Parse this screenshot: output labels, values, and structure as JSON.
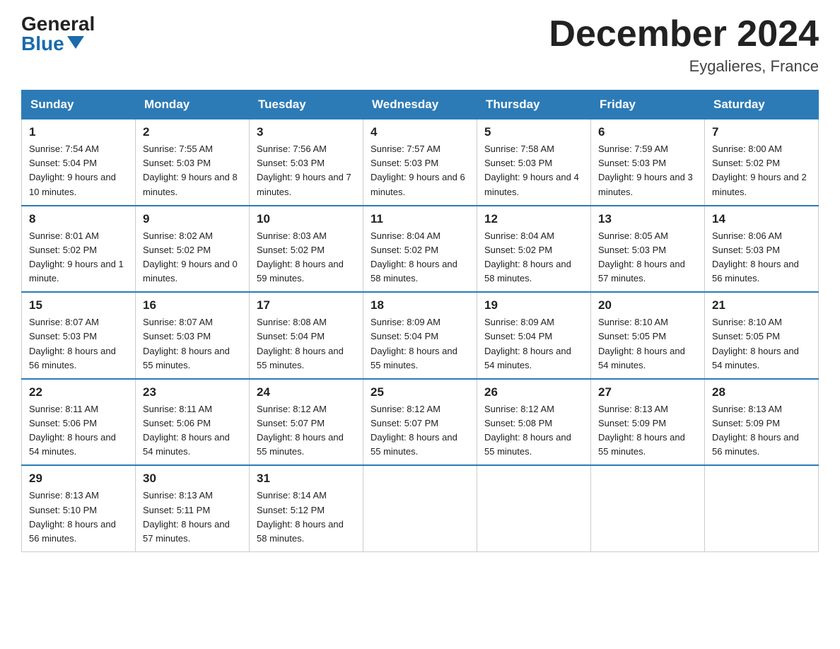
{
  "header": {
    "logo_general": "General",
    "logo_blue": "Blue",
    "month_title": "December 2024",
    "location": "Eygalieres, France"
  },
  "days_of_week": [
    "Sunday",
    "Monday",
    "Tuesday",
    "Wednesday",
    "Thursday",
    "Friday",
    "Saturday"
  ],
  "weeks": [
    [
      {
        "day": "1",
        "sunrise": "7:54 AM",
        "sunset": "5:04 PM",
        "daylight": "9 hours and 10 minutes."
      },
      {
        "day": "2",
        "sunrise": "7:55 AM",
        "sunset": "5:03 PM",
        "daylight": "9 hours and 8 minutes."
      },
      {
        "day": "3",
        "sunrise": "7:56 AM",
        "sunset": "5:03 PM",
        "daylight": "9 hours and 7 minutes."
      },
      {
        "day": "4",
        "sunrise": "7:57 AM",
        "sunset": "5:03 PM",
        "daylight": "9 hours and 6 minutes."
      },
      {
        "day": "5",
        "sunrise": "7:58 AM",
        "sunset": "5:03 PM",
        "daylight": "9 hours and 4 minutes."
      },
      {
        "day": "6",
        "sunrise": "7:59 AM",
        "sunset": "5:03 PM",
        "daylight": "9 hours and 3 minutes."
      },
      {
        "day": "7",
        "sunrise": "8:00 AM",
        "sunset": "5:02 PM",
        "daylight": "9 hours and 2 minutes."
      }
    ],
    [
      {
        "day": "8",
        "sunrise": "8:01 AM",
        "sunset": "5:02 PM",
        "daylight": "9 hours and 1 minute."
      },
      {
        "day": "9",
        "sunrise": "8:02 AM",
        "sunset": "5:02 PM",
        "daylight": "9 hours and 0 minutes."
      },
      {
        "day": "10",
        "sunrise": "8:03 AM",
        "sunset": "5:02 PM",
        "daylight": "8 hours and 59 minutes."
      },
      {
        "day": "11",
        "sunrise": "8:04 AM",
        "sunset": "5:02 PM",
        "daylight": "8 hours and 58 minutes."
      },
      {
        "day": "12",
        "sunrise": "8:04 AM",
        "sunset": "5:02 PM",
        "daylight": "8 hours and 58 minutes."
      },
      {
        "day": "13",
        "sunrise": "8:05 AM",
        "sunset": "5:03 PM",
        "daylight": "8 hours and 57 minutes."
      },
      {
        "day": "14",
        "sunrise": "8:06 AM",
        "sunset": "5:03 PM",
        "daylight": "8 hours and 56 minutes."
      }
    ],
    [
      {
        "day": "15",
        "sunrise": "8:07 AM",
        "sunset": "5:03 PM",
        "daylight": "8 hours and 56 minutes."
      },
      {
        "day": "16",
        "sunrise": "8:07 AM",
        "sunset": "5:03 PM",
        "daylight": "8 hours and 55 minutes."
      },
      {
        "day": "17",
        "sunrise": "8:08 AM",
        "sunset": "5:04 PM",
        "daylight": "8 hours and 55 minutes."
      },
      {
        "day": "18",
        "sunrise": "8:09 AM",
        "sunset": "5:04 PM",
        "daylight": "8 hours and 55 minutes."
      },
      {
        "day": "19",
        "sunrise": "8:09 AM",
        "sunset": "5:04 PM",
        "daylight": "8 hours and 54 minutes."
      },
      {
        "day": "20",
        "sunrise": "8:10 AM",
        "sunset": "5:05 PM",
        "daylight": "8 hours and 54 minutes."
      },
      {
        "day": "21",
        "sunrise": "8:10 AM",
        "sunset": "5:05 PM",
        "daylight": "8 hours and 54 minutes."
      }
    ],
    [
      {
        "day": "22",
        "sunrise": "8:11 AM",
        "sunset": "5:06 PM",
        "daylight": "8 hours and 54 minutes."
      },
      {
        "day": "23",
        "sunrise": "8:11 AM",
        "sunset": "5:06 PM",
        "daylight": "8 hours and 54 minutes."
      },
      {
        "day": "24",
        "sunrise": "8:12 AM",
        "sunset": "5:07 PM",
        "daylight": "8 hours and 55 minutes."
      },
      {
        "day": "25",
        "sunrise": "8:12 AM",
        "sunset": "5:07 PM",
        "daylight": "8 hours and 55 minutes."
      },
      {
        "day": "26",
        "sunrise": "8:12 AM",
        "sunset": "5:08 PM",
        "daylight": "8 hours and 55 minutes."
      },
      {
        "day": "27",
        "sunrise": "8:13 AM",
        "sunset": "5:09 PM",
        "daylight": "8 hours and 55 minutes."
      },
      {
        "day": "28",
        "sunrise": "8:13 AM",
        "sunset": "5:09 PM",
        "daylight": "8 hours and 56 minutes."
      }
    ],
    [
      {
        "day": "29",
        "sunrise": "8:13 AM",
        "sunset": "5:10 PM",
        "daylight": "8 hours and 56 minutes."
      },
      {
        "day": "30",
        "sunrise": "8:13 AM",
        "sunset": "5:11 PM",
        "daylight": "8 hours and 57 minutes."
      },
      {
        "day": "31",
        "sunrise": "8:14 AM",
        "sunset": "5:12 PM",
        "daylight": "8 hours and 58 minutes."
      },
      null,
      null,
      null,
      null
    ]
  ]
}
